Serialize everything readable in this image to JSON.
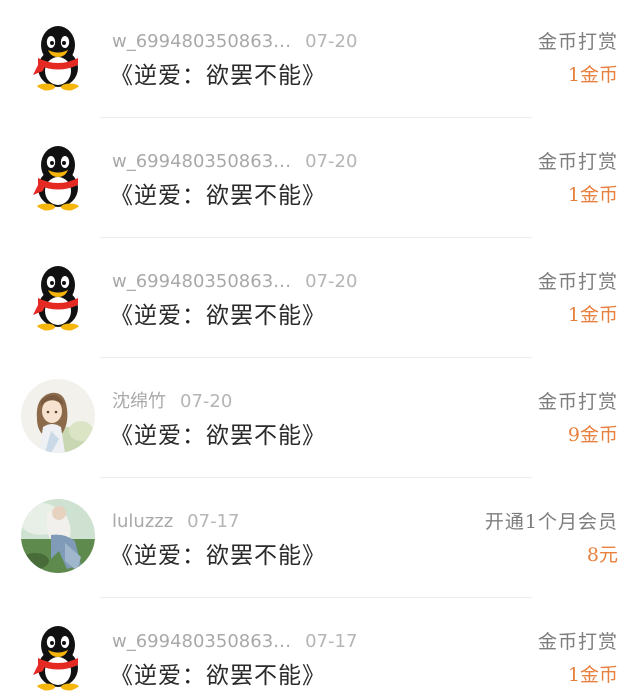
{
  "colors": {
    "amount": "#e8813f",
    "name": "#a9a9a9",
    "book_title": "#2a2a2a",
    "reward_type": "#7d7d7d"
  },
  "records": [
    {
      "avatar": "qq-penguin-icon",
      "user": "w_699480350863…",
      "date": "07-20",
      "book": "《逆爱：欲罢不能》",
      "reward_type": "金币打赏",
      "amount": "1金币"
    },
    {
      "avatar": "qq-penguin-icon",
      "user": "w_699480350863…",
      "date": "07-20",
      "book": "《逆爱：欲罢不能》",
      "reward_type": "金币打赏",
      "amount": "1金币"
    },
    {
      "avatar": "qq-penguin-icon",
      "user": "w_699480350863…",
      "date": "07-20",
      "book": "《逆爱：欲罢不能》",
      "reward_type": "金币打赏",
      "amount": "1金币"
    },
    {
      "avatar": "anime-girl-avatar",
      "user": "沈绵竹",
      "date": "07-20",
      "book": "《逆爱：欲罢不能》",
      "reward_type": "金币打赏",
      "amount": "9金币"
    },
    {
      "avatar": "photo-avatar",
      "user": "luluzzz",
      "date": "07-17",
      "book": "《逆爱：欲罢不能》",
      "reward_type": "开通1个月会员",
      "amount": "8元"
    },
    {
      "avatar": "qq-penguin-icon",
      "user": "w_699480350863…",
      "date": "07-17",
      "book": "《逆爱：欲罢不能》",
      "reward_type": "金币打赏",
      "amount": "1金币"
    }
  ]
}
